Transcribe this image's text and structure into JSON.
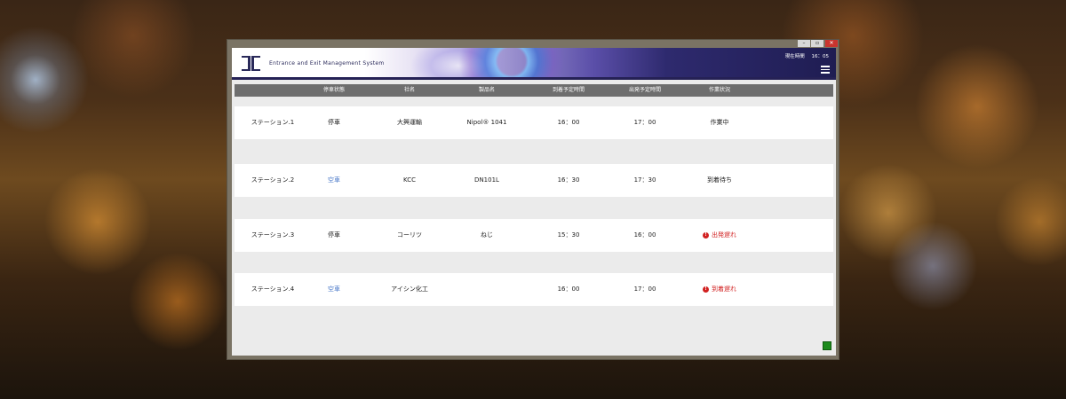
{
  "window": {
    "controls": {
      "minimize": "–",
      "maximize": "▫",
      "close": "✕"
    }
  },
  "header": {
    "app_title": "Entrance and Exit Management System",
    "clock_label": "現在時間",
    "clock_value": "16：05"
  },
  "table": {
    "columns": [
      "",
      "停車状態",
      "社名",
      "製品名",
      "到着予定時間",
      "出発予定時間",
      "作業状況"
    ],
    "rows": [
      {
        "station": "ステーション.1",
        "parking": "停車",
        "parking_state": "parked",
        "company": "大興運輸",
        "product": "Nipol® 1041",
        "arrival": "16：00",
        "departure": "17：00",
        "work": "作業中",
        "work_alert": false
      },
      {
        "station": "ステーション.2",
        "parking": "空車",
        "parking_state": "vacant",
        "company": "KCC",
        "product": "DN101L",
        "arrival": "16：30",
        "departure": "17：30",
        "work": "到着待ち",
        "work_alert": false
      },
      {
        "station": "ステーション.3",
        "parking": "停車",
        "parking_state": "parked",
        "company": "コーリツ",
        "product": "ねじ",
        "arrival": "15：30",
        "departure": "16：00",
        "work": "出発遅れ",
        "work_alert": true
      },
      {
        "station": "ステーション.4",
        "parking": "空車",
        "parking_state": "vacant",
        "company": "アイシン化工",
        "product": "",
        "arrival": "16：00",
        "departure": "17：00",
        "work": "到着遅れ",
        "work_alert": true
      }
    ]
  },
  "alert_icon_glyph": "!",
  "colors": {
    "header_dark": "#252155",
    "vacant_text": "#4a78c8",
    "alert_red": "#d12020",
    "status_indicator": "#1b8a1b"
  }
}
